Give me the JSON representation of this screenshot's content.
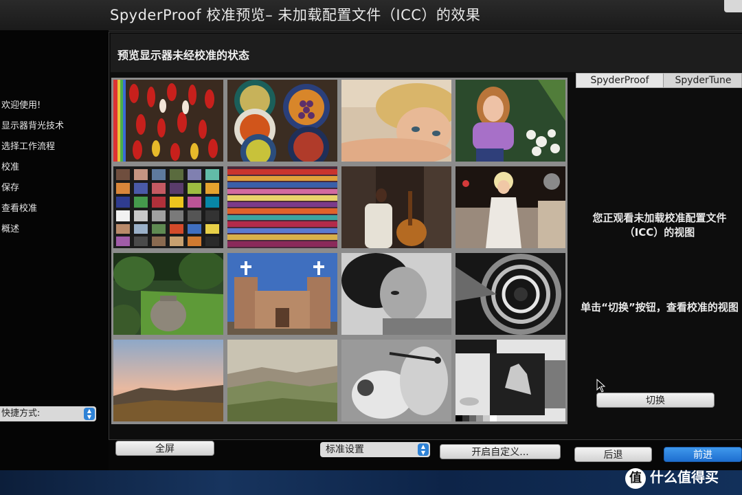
{
  "window": {
    "title": "SpyderProof 校准预览– 未加载配置文件（ICC）的效果"
  },
  "sidebar": {
    "steps": [
      "欢迎使用!",
      "显示器背光技术",
      "选择工作流程",
      "校准",
      "保存",
      "查看校准",
      "概述"
    ],
    "shortcut_label": "快捷方式:"
  },
  "panel": {
    "header": "预览显示器未经校准的状态"
  },
  "tabs": [
    "SpyderProof",
    "SpyderTune"
  ],
  "info": {
    "line1": "您正观看未加载校准配置文件（ICC）的视图",
    "line2": "单击“切换”按钮，查看校准的视图"
  },
  "buttons": {
    "toggle": "切换",
    "fullscreen": "全屏",
    "preset_select": "标准设置",
    "customize": "开启自定义...",
    "back": "后退",
    "next": "前进"
  },
  "watermark": {
    "icon_char": "值",
    "text": "什么值得买"
  },
  "colors": {
    "accent": "#2e82d6",
    "background": "#070707"
  }
}
